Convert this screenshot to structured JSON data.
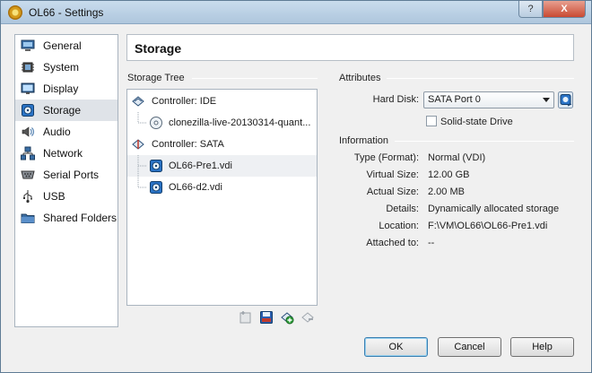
{
  "window": {
    "title": "OL66 - Settings",
    "help_glyph": "?",
    "close_glyph": "X"
  },
  "nav": {
    "items": [
      {
        "label": "General",
        "icon": "monitor-general-icon",
        "selected": false
      },
      {
        "label": "System",
        "icon": "chip-system-icon",
        "selected": false
      },
      {
        "label": "Display",
        "icon": "display-icon",
        "selected": false
      },
      {
        "label": "Storage",
        "icon": "disk-storage-icon",
        "selected": true
      },
      {
        "label": "Audio",
        "icon": "speaker-audio-icon",
        "selected": false
      },
      {
        "label": "Network",
        "icon": "network-icon",
        "selected": false
      },
      {
        "label": "Serial Ports",
        "icon": "serial-port-icon",
        "selected": false
      },
      {
        "label": "USB",
        "icon": "usb-icon",
        "selected": false
      },
      {
        "label": "Shared Folders",
        "icon": "folder-icon",
        "selected": false
      }
    ]
  },
  "header": {
    "title": "Storage"
  },
  "storage_tree": {
    "label": "Storage Tree",
    "rows": [
      {
        "text": "Controller: IDE",
        "icon": "ide-controller-icon",
        "kind": "controller"
      },
      {
        "text": "clonezilla-live-20130314-quant...",
        "icon": "optical-disc-icon",
        "kind": "child"
      },
      {
        "text": "Controller: SATA",
        "icon": "sata-controller-icon",
        "kind": "controller"
      },
      {
        "text": "OL66-Pre1.vdi",
        "icon": "hard-disk-icon",
        "kind": "child",
        "selected": true
      },
      {
        "text": "OL66-d2.vdi",
        "icon": "hard-disk-icon",
        "kind": "child"
      }
    ],
    "toolbar": [
      "add-controller-icon",
      "remove-attachment-icon",
      "add-attachment-icon",
      "remove-controller-icon"
    ]
  },
  "attributes": {
    "label": "Attributes",
    "hard_disk_label": "Hard Disk:",
    "hard_disk_value": "SATA Port 0",
    "ssd_label": "Solid-state Drive",
    "ssd_checked": false
  },
  "information": {
    "label": "Information",
    "rows": [
      {
        "label": "Type (Format):",
        "value": "Normal (VDI)"
      },
      {
        "label": "Virtual Size:",
        "value": "12.00 GB"
      },
      {
        "label": "Actual Size:",
        "value": "2.00 MB"
      },
      {
        "label": "Details:",
        "value": "Dynamically allocated storage"
      },
      {
        "label": "Location:",
        "value": "F:\\VM\\OL66\\OL66-Pre1.vdi"
      },
      {
        "label": "Attached to:",
        "value": "--"
      }
    ]
  },
  "buttons": {
    "ok": "OK",
    "cancel": "Cancel",
    "help": "Help"
  },
  "colors": {
    "accent": "#3c7fb1",
    "selection": "#dfe3e8"
  }
}
